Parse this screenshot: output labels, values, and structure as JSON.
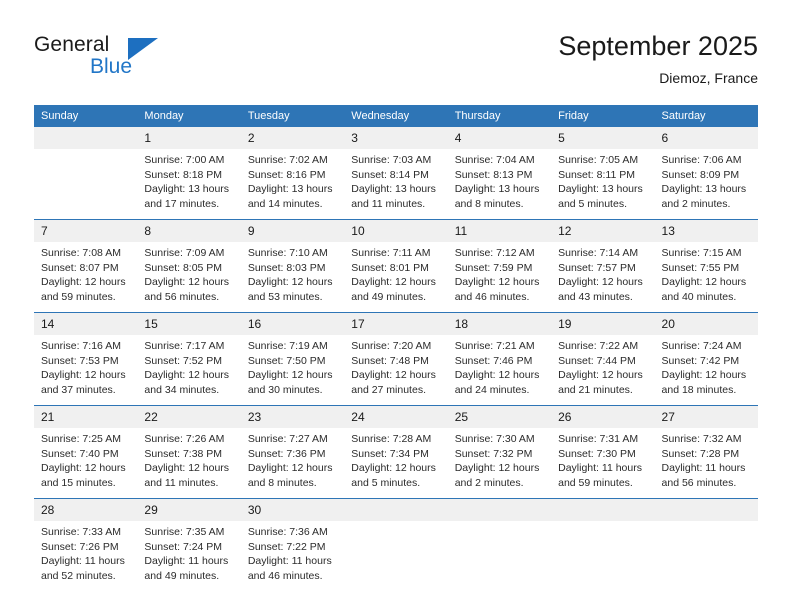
{
  "brand": {
    "name_line1": "General",
    "name_line2": "Blue",
    "logo_icon": "triangle-icon",
    "accent_color": "#1d6fc0"
  },
  "header": {
    "title": "September 2025",
    "subtitle": "Diemoz, France"
  },
  "theme": {
    "header_blue": "#2e75b6",
    "daynum_band": "#f0f0f0",
    "text": "#1a1a1a"
  },
  "calendar": {
    "weekday_headers": [
      "Sunday",
      "Monday",
      "Tuesday",
      "Wednesday",
      "Thursday",
      "Friday",
      "Saturday"
    ],
    "weeks": [
      [
        {
          "day": "",
          "sunrise": "",
          "sunset": "",
          "daylight": ""
        },
        {
          "day": "1",
          "sunrise": "Sunrise: 7:00 AM",
          "sunset": "Sunset: 8:18 PM",
          "daylight": "Daylight: 13 hours and 17 minutes."
        },
        {
          "day": "2",
          "sunrise": "Sunrise: 7:02 AM",
          "sunset": "Sunset: 8:16 PM",
          "daylight": "Daylight: 13 hours and 14 minutes."
        },
        {
          "day": "3",
          "sunrise": "Sunrise: 7:03 AM",
          "sunset": "Sunset: 8:14 PM",
          "daylight": "Daylight: 13 hours and 11 minutes."
        },
        {
          "day": "4",
          "sunrise": "Sunrise: 7:04 AM",
          "sunset": "Sunset: 8:13 PM",
          "daylight": "Daylight: 13 hours and 8 minutes."
        },
        {
          "day": "5",
          "sunrise": "Sunrise: 7:05 AM",
          "sunset": "Sunset: 8:11 PM",
          "daylight": "Daylight: 13 hours and 5 minutes."
        },
        {
          "day": "6",
          "sunrise": "Sunrise: 7:06 AM",
          "sunset": "Sunset: 8:09 PM",
          "daylight": "Daylight: 13 hours and 2 minutes."
        }
      ],
      [
        {
          "day": "7",
          "sunrise": "Sunrise: 7:08 AM",
          "sunset": "Sunset: 8:07 PM",
          "daylight": "Daylight: 12 hours and 59 minutes."
        },
        {
          "day": "8",
          "sunrise": "Sunrise: 7:09 AM",
          "sunset": "Sunset: 8:05 PM",
          "daylight": "Daylight: 12 hours and 56 minutes."
        },
        {
          "day": "9",
          "sunrise": "Sunrise: 7:10 AM",
          "sunset": "Sunset: 8:03 PM",
          "daylight": "Daylight: 12 hours and 53 minutes."
        },
        {
          "day": "10",
          "sunrise": "Sunrise: 7:11 AM",
          "sunset": "Sunset: 8:01 PM",
          "daylight": "Daylight: 12 hours and 49 minutes."
        },
        {
          "day": "11",
          "sunrise": "Sunrise: 7:12 AM",
          "sunset": "Sunset: 7:59 PM",
          "daylight": "Daylight: 12 hours and 46 minutes."
        },
        {
          "day": "12",
          "sunrise": "Sunrise: 7:14 AM",
          "sunset": "Sunset: 7:57 PM",
          "daylight": "Daylight: 12 hours and 43 minutes."
        },
        {
          "day": "13",
          "sunrise": "Sunrise: 7:15 AM",
          "sunset": "Sunset: 7:55 PM",
          "daylight": "Daylight: 12 hours and 40 minutes."
        }
      ],
      [
        {
          "day": "14",
          "sunrise": "Sunrise: 7:16 AM",
          "sunset": "Sunset: 7:53 PM",
          "daylight": "Daylight: 12 hours and 37 minutes."
        },
        {
          "day": "15",
          "sunrise": "Sunrise: 7:17 AM",
          "sunset": "Sunset: 7:52 PM",
          "daylight": "Daylight: 12 hours and 34 minutes."
        },
        {
          "day": "16",
          "sunrise": "Sunrise: 7:19 AM",
          "sunset": "Sunset: 7:50 PM",
          "daylight": "Daylight: 12 hours and 30 minutes."
        },
        {
          "day": "17",
          "sunrise": "Sunrise: 7:20 AM",
          "sunset": "Sunset: 7:48 PM",
          "daylight": "Daylight: 12 hours and 27 minutes."
        },
        {
          "day": "18",
          "sunrise": "Sunrise: 7:21 AM",
          "sunset": "Sunset: 7:46 PM",
          "daylight": "Daylight: 12 hours and 24 minutes."
        },
        {
          "day": "19",
          "sunrise": "Sunrise: 7:22 AM",
          "sunset": "Sunset: 7:44 PM",
          "daylight": "Daylight: 12 hours and 21 minutes."
        },
        {
          "day": "20",
          "sunrise": "Sunrise: 7:24 AM",
          "sunset": "Sunset: 7:42 PM",
          "daylight": "Daylight: 12 hours and 18 minutes."
        }
      ],
      [
        {
          "day": "21",
          "sunrise": "Sunrise: 7:25 AM",
          "sunset": "Sunset: 7:40 PM",
          "daylight": "Daylight: 12 hours and 15 minutes."
        },
        {
          "day": "22",
          "sunrise": "Sunrise: 7:26 AM",
          "sunset": "Sunset: 7:38 PM",
          "daylight": "Daylight: 12 hours and 11 minutes."
        },
        {
          "day": "23",
          "sunrise": "Sunrise: 7:27 AM",
          "sunset": "Sunset: 7:36 PM",
          "daylight": "Daylight: 12 hours and 8 minutes."
        },
        {
          "day": "24",
          "sunrise": "Sunrise: 7:28 AM",
          "sunset": "Sunset: 7:34 PM",
          "daylight": "Daylight: 12 hours and 5 minutes."
        },
        {
          "day": "25",
          "sunrise": "Sunrise: 7:30 AM",
          "sunset": "Sunset: 7:32 PM",
          "daylight": "Daylight: 12 hours and 2 minutes."
        },
        {
          "day": "26",
          "sunrise": "Sunrise: 7:31 AM",
          "sunset": "Sunset: 7:30 PM",
          "daylight": "Daylight: 11 hours and 59 minutes."
        },
        {
          "day": "27",
          "sunrise": "Sunrise: 7:32 AM",
          "sunset": "Sunset: 7:28 PM",
          "daylight": "Daylight: 11 hours and 56 minutes."
        }
      ],
      [
        {
          "day": "28",
          "sunrise": "Sunrise: 7:33 AM",
          "sunset": "Sunset: 7:26 PM",
          "daylight": "Daylight: 11 hours and 52 minutes."
        },
        {
          "day": "29",
          "sunrise": "Sunrise: 7:35 AM",
          "sunset": "Sunset: 7:24 PM",
          "daylight": "Daylight: 11 hours and 49 minutes."
        },
        {
          "day": "30",
          "sunrise": "Sunrise: 7:36 AM",
          "sunset": "Sunset: 7:22 PM",
          "daylight": "Daylight: 11 hours and 46 minutes."
        },
        {
          "day": "",
          "sunrise": "",
          "sunset": "",
          "daylight": ""
        },
        {
          "day": "",
          "sunrise": "",
          "sunset": "",
          "daylight": ""
        },
        {
          "day": "",
          "sunrise": "",
          "sunset": "",
          "daylight": ""
        },
        {
          "day": "",
          "sunrise": "",
          "sunset": "",
          "daylight": ""
        }
      ]
    ]
  }
}
